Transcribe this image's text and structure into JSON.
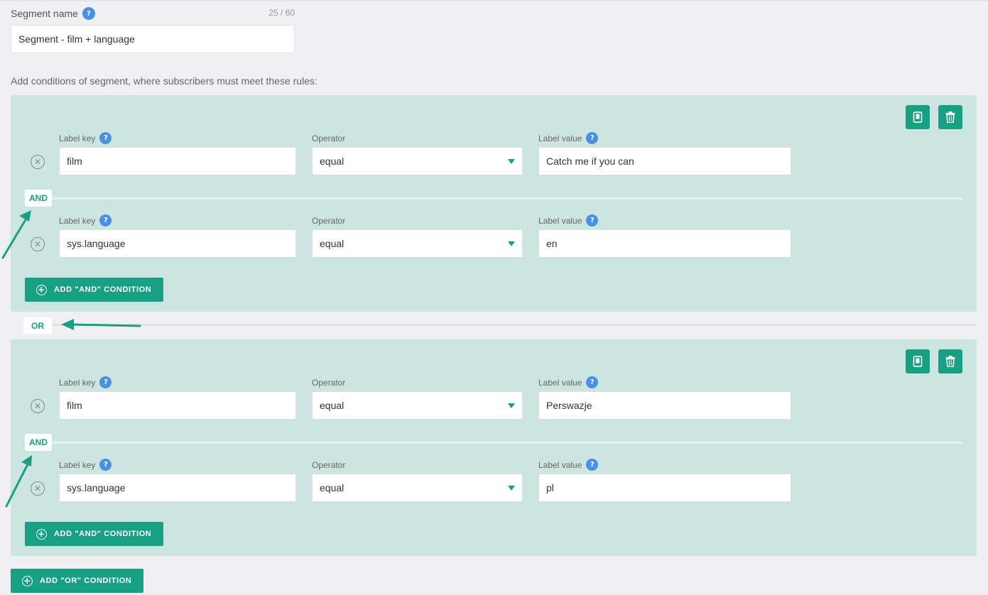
{
  "segment": {
    "label": "Segment name",
    "help": "?",
    "counter": "25 / 60",
    "value": "Segment - film + language"
  },
  "intro": "Add conditions of segment, where subscribers must meet these rules:",
  "labels": {
    "label_key": "Label key",
    "operator": "Operator",
    "label_value": "Label value",
    "and": "AND",
    "or": "OR",
    "add_and": "ADD \"AND\" CONDITION",
    "add_or": "ADD \"OR\" CONDITION"
  },
  "groups": [
    {
      "conditions": [
        {
          "key": "film",
          "operator": "equal",
          "value": "Catch me if you can"
        },
        {
          "key": "sys.language",
          "operator": "equal",
          "value": "en"
        }
      ]
    },
    {
      "conditions": [
        {
          "key": "film",
          "operator": "equal",
          "value": "Perswazje"
        },
        {
          "key": "sys.language",
          "operator": "equal",
          "value": "pl"
        }
      ]
    }
  ],
  "icons": {
    "copy": "copy-icon",
    "trash": "trash-icon",
    "remove": "remove-circle-icon",
    "plus": "plus-circle-icon",
    "help": "help-icon",
    "caret": "caret-down-icon"
  },
  "colors": {
    "accent": "#17a084",
    "group_bg": "#cce5e0",
    "help_blue": "#4a90e2",
    "annotation_arrow": "#17a084"
  }
}
